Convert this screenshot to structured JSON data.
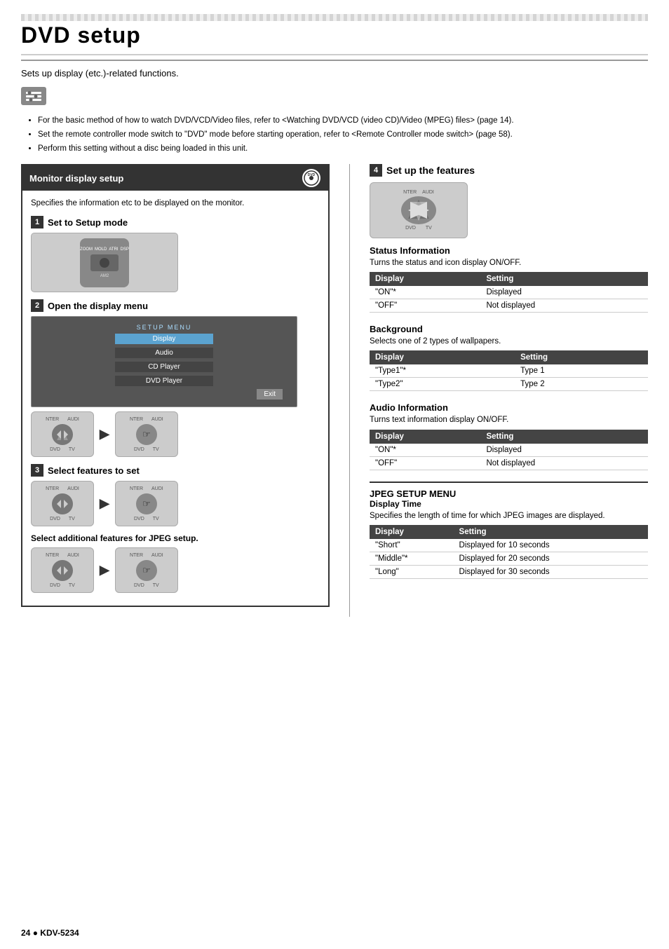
{
  "page": {
    "title": "DVD setup",
    "subtitle": "Sets up display (etc.)-related functions.",
    "bullets": [
      "For the basic method of how to watch DVD/VCD/Video files, refer to <Watching DVD/VCD (video CD)/Video (MPEG) files> (page 14).",
      "Set the remote controller mode switch to \"DVD\" mode before starting operation, refer to <Remote Controller mode switch> (page 58).",
      "Perform this setting without a disc being loaded in this unit."
    ]
  },
  "monitor_section": {
    "title": "Monitor display setup",
    "desc": "Specifies the information etc to be displayed on the monitor.",
    "dvd_label": "DVD"
  },
  "steps": {
    "step1": {
      "num": "1",
      "label": "Set to Setup mode"
    },
    "step2": {
      "num": "2",
      "label": "Open the display menu"
    },
    "step3": {
      "num": "3",
      "label": "Select features to set"
    },
    "step3_sub": "Select additional features for JPEG setup.",
    "step4": {
      "num": "4",
      "label": "Set up the features"
    }
  },
  "menu_items": [
    {
      "label": "SETUP MENU",
      "type": "header"
    },
    {
      "label": "Display",
      "type": "selected"
    },
    {
      "label": "Audio",
      "type": "dark"
    },
    {
      "label": "CD Player",
      "type": "dark"
    },
    {
      "label": "DVD Player",
      "type": "dark"
    },
    {
      "label": "Exit",
      "type": "exit"
    }
  ],
  "ctrl_labels": {
    "nter": "NTER",
    "audi": "AUDI",
    "dvd_tv": "DVD TV"
  },
  "status_info": {
    "heading": "Status Information",
    "desc": "Turns the status and icon display ON/OFF.",
    "columns": [
      "Display",
      "Setting"
    ],
    "rows": [
      {
        "display": "\"ON\"*",
        "setting": "Displayed"
      },
      {
        "display": "\"OFF\"",
        "setting": "Not displayed"
      }
    ]
  },
  "background_info": {
    "heading": "Background",
    "desc": "Selects one of 2 types of wallpapers.",
    "columns": [
      "Display",
      "Setting"
    ],
    "rows": [
      {
        "display": "\"Type1\"*",
        "setting": "Type 1"
      },
      {
        "display": "\"Type2\"",
        "setting": "Type 2"
      }
    ]
  },
  "audio_info": {
    "heading": "Audio Information",
    "desc": "Turns text information display ON/OFF.",
    "columns": [
      "Display",
      "Setting"
    ],
    "rows": [
      {
        "display": "\"ON\"*",
        "setting": "Displayed"
      },
      {
        "display": "\"OFF\"",
        "setting": "Not displayed"
      }
    ]
  },
  "jpeg_setup": {
    "section_title": "JPEG SETUP MENU",
    "subtitle": "Display Time",
    "desc": "Specifies the length of time for which JPEG images are displayed.",
    "columns": [
      "Display",
      "Setting"
    ],
    "rows": [
      {
        "display": "\"Short\"",
        "setting": "Displayed for 10 seconds"
      },
      {
        "display": "\"Middle\"*",
        "setting": "Displayed for 20 seconds"
      },
      {
        "display": "\"Long\"",
        "setting": "Displayed for 30 seconds"
      }
    ]
  },
  "footer": {
    "page_num": "24",
    "model": "KDV-5234"
  }
}
